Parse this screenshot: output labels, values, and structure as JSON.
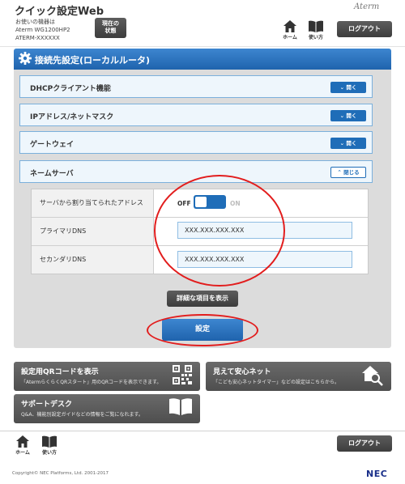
{
  "header": {
    "title": "クイック設定Web",
    "device_label": "お使いの機器は",
    "model": "Aterm WG1200HP2",
    "serial": "ATERM-XXXXXX",
    "status_button_line1": "現在の",
    "status_button_line2": "状態",
    "brand": "Aterm",
    "home_label": "ホーム",
    "howto_label": "使い方",
    "logout_label": "ログアウト"
  },
  "panel": {
    "title": "接続先設定(ローカルルータ)",
    "sections": [
      {
        "label": "DHCPクライアント機能",
        "toggle": "開く"
      },
      {
        "label": "IPアドレス/ネットマスク",
        "toggle": "開く"
      },
      {
        "label": "ゲートウェイ",
        "toggle": "開く"
      },
      {
        "label": "ネームサーバ",
        "toggle": "閉じる"
      }
    ],
    "nameserver": {
      "auto_label": "サーバから割り当てられたアドレス",
      "toggle_off": "OFF",
      "toggle_on": "ON",
      "toggle_state": "OFF",
      "primary_label": "プライマリDNS",
      "primary_value": "XXX.XXX.XXX.XXX",
      "secondary_label": "セカンダリDNS",
      "secondary_value": "XXX.XXX.XXX.XXX"
    },
    "detail_button": "詳細な項目を表示",
    "set_button": "設定"
  },
  "tiles": {
    "qr": {
      "title": "設定用QRコードを表示",
      "sub": "「AtermらくらくQRスタート」用のQRコードを表示できます。"
    },
    "safe": {
      "title": "見えて安心ネット",
      "sub": "「こども安心ネットタイマー」などの設定はこちらから。"
    },
    "support": {
      "title": "サポートデスク",
      "sub": "Q&A、機能別設定ガイドなどの情報をご覧になれます。"
    }
  },
  "footer": {
    "home_label": "ホーム",
    "howto_label": "使い方",
    "logout_label": "ログアウト",
    "copyright": "Copyright© NEC Platforms, Ltd. 2001-2017",
    "logo": "NEC"
  },
  "icons": {
    "gear": "gear-icon",
    "home": "home-icon",
    "book": "book-icon",
    "qr": "qr-code-icon",
    "house_search": "house-search-icon",
    "chevron_down": "chevron-down-icon",
    "chevron_up": "chevron-up-icon"
  },
  "colors": {
    "accent": "#1f6db8",
    "header_bar": "#2a74c0",
    "highlight_ring": "#e21d1d",
    "dark_button": "#4a4a4a",
    "panel_bg": "#dcdcdc"
  }
}
